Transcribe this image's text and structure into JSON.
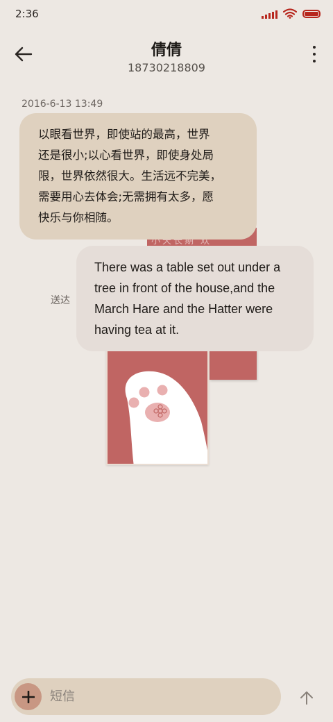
{
  "status_bar": {
    "time": "2:36",
    "icons": [
      "signal-icon",
      "wifi-icon",
      "battery-icon"
    ],
    "battery_level": 1.0
  },
  "header": {
    "contact_name": "倩倩",
    "contact_number": "18730218809",
    "back_icon": "back-arrow-icon",
    "more_icon": "more-vertical-icon"
  },
  "conversation": {
    "timestamp": "2016-6-13 13:49",
    "incoming_message": "以眼看世界，即使站的最高，世界\n还是很小;以心看世界，即使身处局\n限，世界依然很大。生活远不完美，\n需要用心去体会;无需拥有太多，愿\n快乐与你相随。",
    "outgoing_message": "There was a table set out under a tree in front of the house,and the March Hare and the Hatter were having tea at it.",
    "outgoing_status": "送达",
    "photo_back_text": "小天长期    欢"
  },
  "composer": {
    "placeholder": "短信",
    "add_icon": "plus-icon",
    "send_icon": "send-arrow-icon"
  },
  "colors": {
    "background": "#ede8e3",
    "incoming_bubble": "#dfd1bf",
    "outgoing_bubble": "#e5ddd8",
    "accent_red": "#b7271e",
    "photo_red": "#c06563",
    "paw_pad": "#e9b0b0"
  }
}
